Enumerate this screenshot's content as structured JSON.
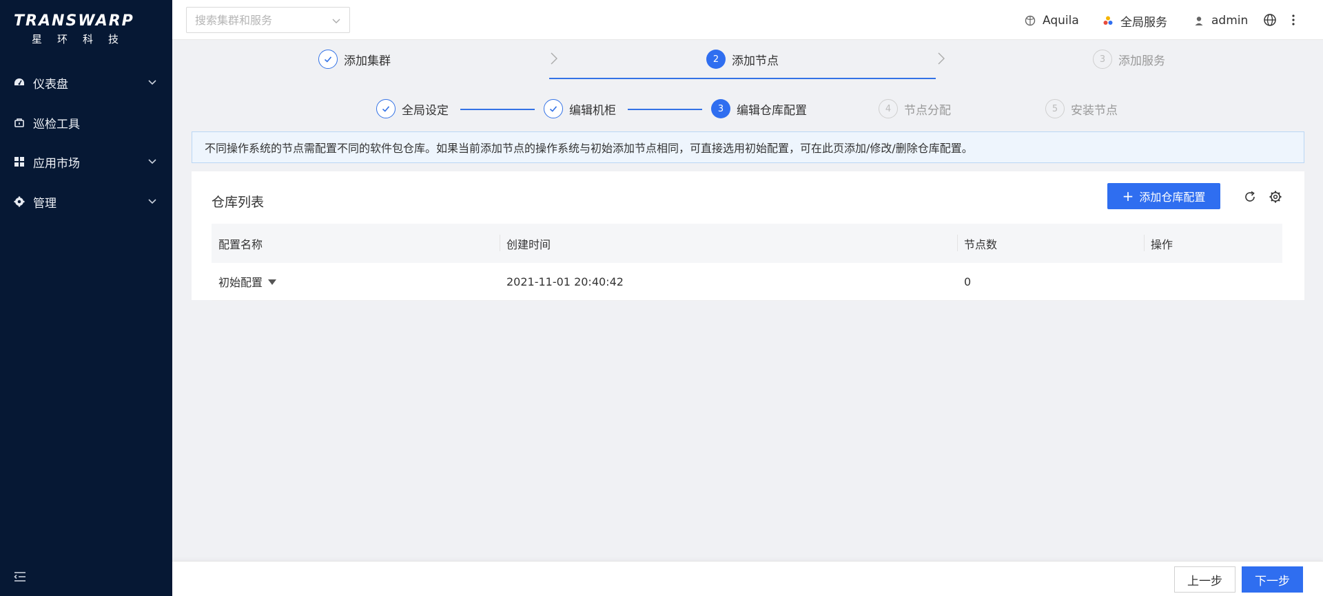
{
  "brand": {
    "name": "TRANSWARP",
    "subtitle": "星环科技"
  },
  "sidebar": {
    "items": [
      {
        "label": "仪表盘",
        "icon": "dashboard-icon",
        "expandable": true
      },
      {
        "label": "巡检工具",
        "icon": "inspection-icon",
        "expandable": false
      },
      {
        "label": "应用市场",
        "icon": "apps-grid-icon",
        "expandable": true
      },
      {
        "label": "管理",
        "icon": "gear-icon",
        "expandable": true
      }
    ]
  },
  "header": {
    "search_placeholder": "搜索集群和服务",
    "cluster_label": "Aquila",
    "global_services_label": "全局服务",
    "user_label": "admin"
  },
  "wizard": {
    "top_steps": [
      {
        "label": "添加集群",
        "status": "done",
        "number": "1"
      },
      {
        "label": "添加节点",
        "status": "active",
        "number": "2"
      },
      {
        "label": "添加服务",
        "status": "pending",
        "number": "3"
      }
    ],
    "sub_steps": [
      {
        "label": "全局设定",
        "status": "done",
        "number": "1"
      },
      {
        "label": "编辑机柜",
        "status": "done",
        "number": "2"
      },
      {
        "label": "编辑仓库配置",
        "status": "active",
        "number": "3"
      },
      {
        "label": "节点分配",
        "status": "pending",
        "number": "4"
      },
      {
        "label": "安装节点",
        "status": "pending",
        "number": "5"
      }
    ]
  },
  "alert": {
    "text": "不同操作系统的节点需配置不同的软件包仓库。如果当前添加节点的操作系统与初始添加节点相同，可直接选用初始配置，可在此页添加/修改/删除仓库配置。"
  },
  "repo_panel": {
    "title": "仓库列表",
    "add_button": "添加仓库配置",
    "columns": [
      "配置名称",
      "创建时间",
      "节点数",
      "操作"
    ],
    "rows": [
      {
        "name": "初始配置",
        "created": "2021-11-01 20:40:42",
        "nodes": "0",
        "actions": ""
      }
    ]
  },
  "footer": {
    "prev_label": "上一步",
    "next_label": "下一步"
  },
  "colors": {
    "sidebar_bg": "#061834",
    "primary": "#2f6ef0",
    "alert_bg": "#eef5fd",
    "alert_border": "#b9d6f4"
  }
}
